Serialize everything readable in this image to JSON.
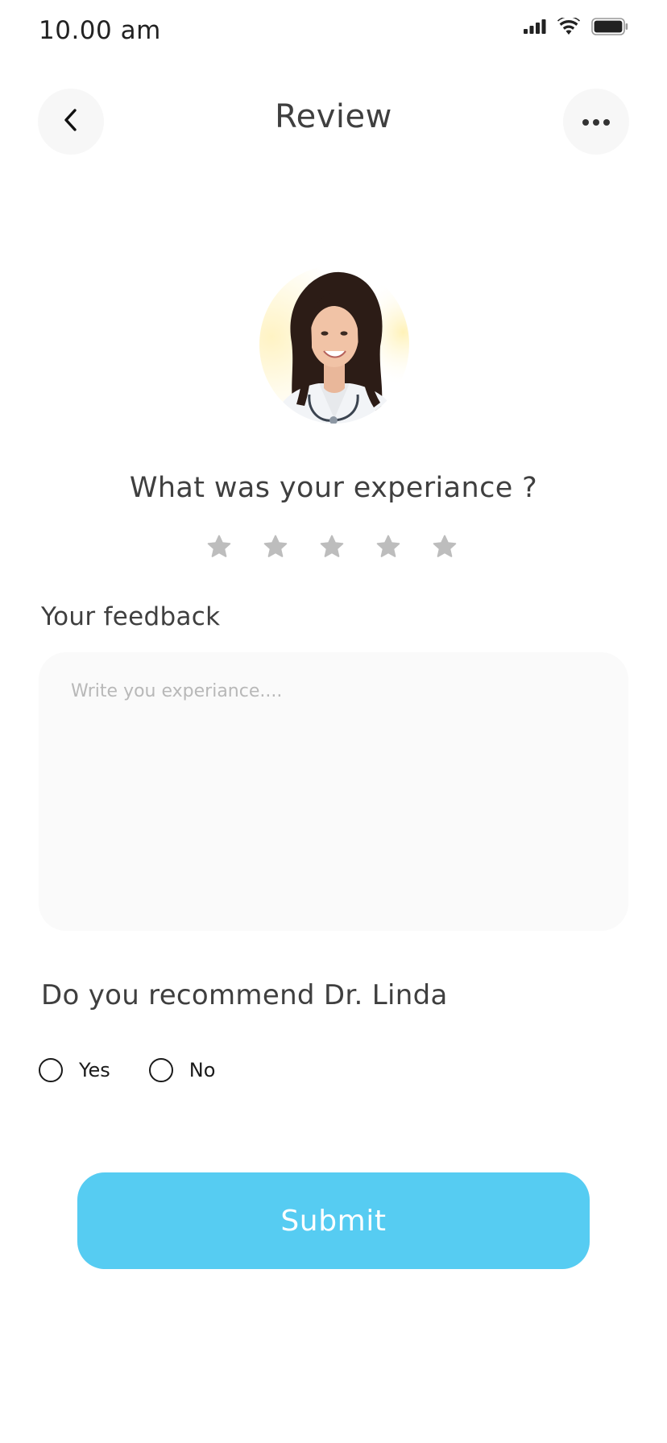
{
  "status_bar": {
    "time": "10.00 am",
    "icons": [
      "signal-icon",
      "wifi-icon",
      "battery-icon"
    ]
  },
  "header": {
    "title": "Review",
    "back_icon": "chevron-left-icon",
    "more_icon": "more-horizontal-icon"
  },
  "doctor": {
    "avatar_icon": "doctor-avatar"
  },
  "rating": {
    "question": "What was your experiance ?",
    "max_stars": 5,
    "selected": 0,
    "star_color": "#bdbdbd"
  },
  "feedback": {
    "label": "Your feedback",
    "placeholder": "Write you experiance....",
    "value": ""
  },
  "recommend": {
    "question": "Do you recommend Dr. Linda",
    "options": [
      {
        "label": "Yes",
        "selected": false
      },
      {
        "label": "No",
        "selected": false
      }
    ]
  },
  "submit": {
    "label": "Submit",
    "color": "#56ccf2"
  }
}
